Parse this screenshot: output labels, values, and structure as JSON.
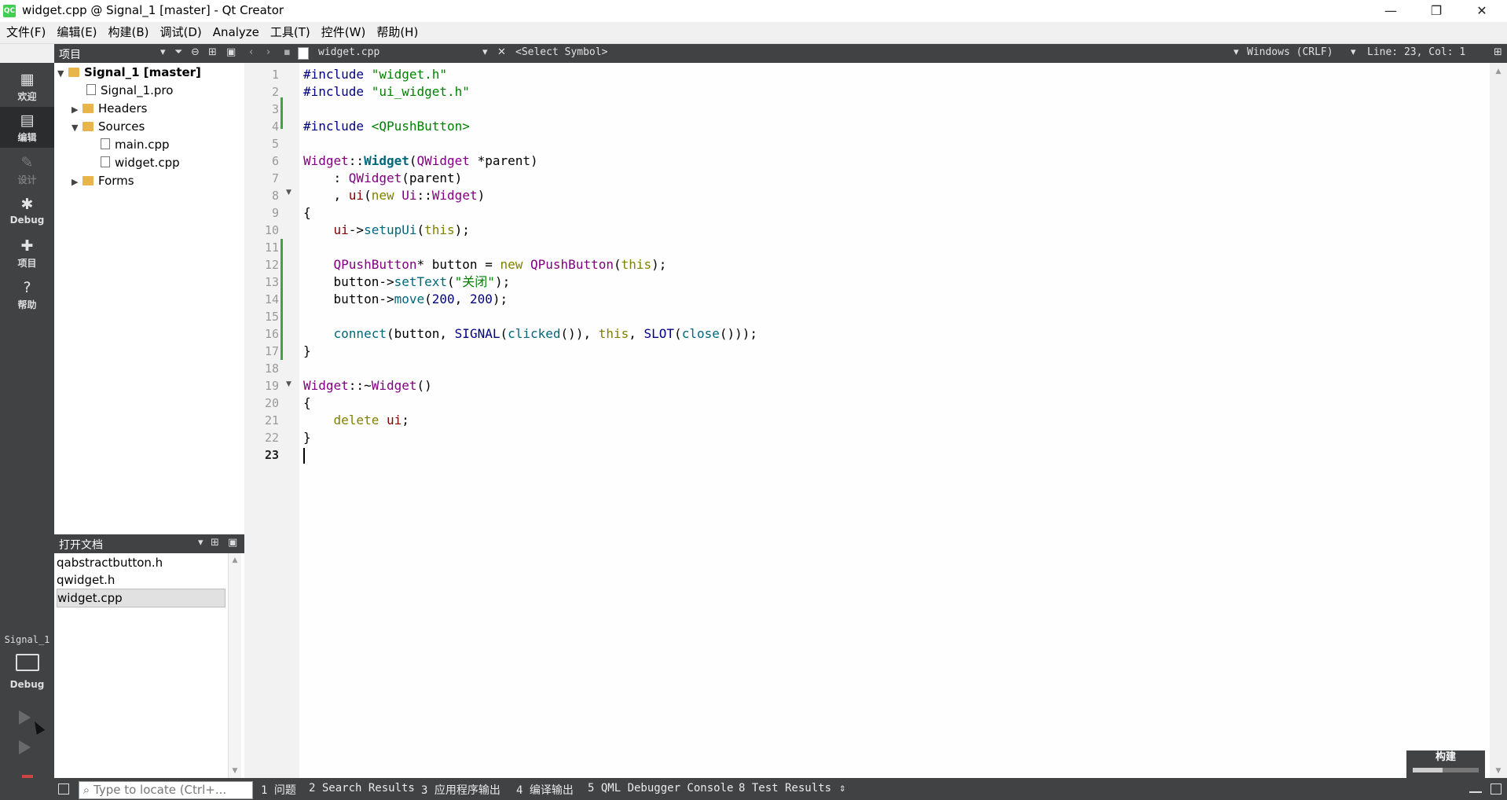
{
  "window": {
    "title": "widget.cpp @ Signal_1 [master] - Qt Creator",
    "logo_text": "QC",
    "minimize": "—",
    "maximize": "❐",
    "close": "✕"
  },
  "menu": [
    "文件(F)",
    "编辑(E)",
    "构建(B)",
    "调试(D)",
    "Analyze",
    "工具(T)",
    "控件(W)",
    "帮助(H)"
  ],
  "modes": [
    {
      "label": "欢迎",
      "icon": "grid-icon",
      "glyph": "▦"
    },
    {
      "label": "编辑",
      "icon": "edit-icon",
      "glyph": "▤"
    },
    {
      "label": "设计",
      "icon": "design-icon",
      "glyph": "✎"
    },
    {
      "label": "Debug",
      "icon": "bug-icon",
      "glyph": "✱"
    },
    {
      "label": "项目",
      "icon": "wrench-icon",
      "glyph": "✚"
    },
    {
      "label": "帮助",
      "icon": "help-icon",
      "glyph": "?"
    }
  ],
  "kit": {
    "project": "Signal_1",
    "config": "Debug"
  },
  "project_pane": {
    "title": "项目",
    "tree": [
      {
        "label": "Signal_1 [master]",
        "type": "root"
      },
      {
        "label": "Signal_1.pro",
        "type": "file"
      },
      {
        "label": "Headers",
        "type": "folder"
      },
      {
        "label": "Sources",
        "type": "folder"
      },
      {
        "label": "main.cpp",
        "type": "file"
      },
      {
        "label": "widget.cpp",
        "type": "file"
      },
      {
        "label": "Forms",
        "type": "folder"
      }
    ]
  },
  "open_docs": {
    "title": "打开文档",
    "items": [
      "qabstractbutton.h",
      "qwidget.h",
      "widget.cpp"
    ],
    "selected": "widget.cpp"
  },
  "editor_toolbar": {
    "file": "widget.cpp",
    "symbol": "<Select Symbol>",
    "line_endings": "Windows (CRLF)",
    "position": "Line: 23, Col: 1"
  },
  "code_lines": [
    "#include \"widget.h\"",
    "#include \"ui_widget.h\"",
    "",
    "#include <QPushButton>",
    "",
    "Widget::Widget(QWidget *parent)",
    "    : QWidget(parent)",
    "    , ui(new Ui::Widget)",
    "{",
    "    ui->setupUi(this);",
    "",
    "    QPushButton* button = new QPushButton(this);",
    "    button->setText(\"关闭\");",
    "    button->move(200, 200);",
    "",
    "    connect(button, SIGNAL(clicked()), this, SLOT(close()));",
    "}",
    "",
    "Widget::~Widget()",
    "{",
    "    delete ui;",
    "}",
    ""
  ],
  "current_line": 23,
  "build": {
    "label": "构建",
    "progress": 0.45
  },
  "statusbar": {
    "locate_placeholder": "Type to locate (Ctrl+...",
    "tabs": [
      "1 问题",
      "2 Search Results",
      "3 应用程序输出",
      "4 编译输出",
      "5 QML Debugger Console",
      "8 Test Results"
    ]
  },
  "colors": {
    "sidebar": "#404244",
    "accent_green": "#41cd52",
    "change_marker": "#3ca63c"
  }
}
